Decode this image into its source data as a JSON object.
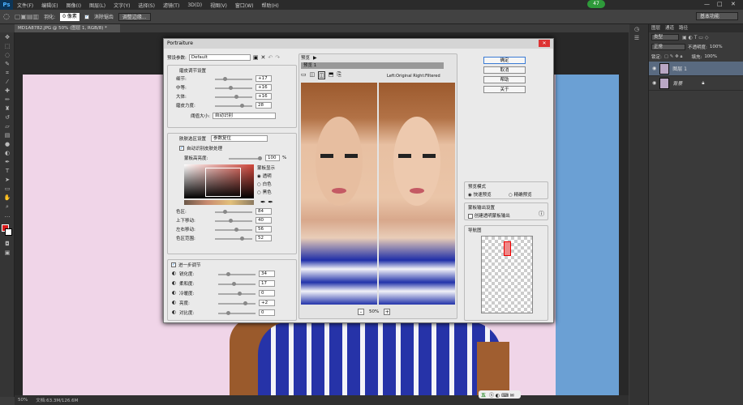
{
  "app": {
    "logo": "Ps",
    "window_controls": [
      "—",
      "□",
      "✕"
    ]
  },
  "menu": [
    "文件(F)",
    "编辑(E)",
    "图像(I)",
    "图层(L)",
    "文字(Y)",
    "选择(S)",
    "滤镜(T)",
    "3D(D)",
    "视图(V)",
    "窗口(W)",
    "帮助(H)"
  ],
  "options": {
    "feather_label": "羽化:",
    "feather_value": "0 像素",
    "antialias_label": "消除锯齿",
    "refine_button": "调整边缘...",
    "workspace": "基本功能"
  },
  "notice_badge": "47",
  "document": {
    "tab": "MD1A8782.JPG @ 50% (图层 1, RGB/8) *",
    "zoom": "50%",
    "doc_size": "文档:63.3M/126.6M"
  },
  "layers_panel": {
    "tabs": [
      "图层",
      "通道",
      "路径"
    ],
    "kind": "类型",
    "blend": "正常",
    "opacity_label": "不透明度:",
    "opacity": "100%",
    "lock_label": "锁定:",
    "fill_label": "填充:",
    "fill": "100%",
    "layers": [
      "图层 1",
      "背景"
    ]
  },
  "plugin": {
    "title": "Portraiture",
    "preset_label": "预设参数:",
    "preset_value": "Default",
    "detail_section": "磨皮调节设置",
    "sliders_detail": [
      {
        "label": "细节:",
        "value": "+17"
      },
      {
        "label": "中等:",
        "value": "+16"
      },
      {
        "label": "大体:",
        "value": "+16"
      },
      {
        "label": "磨皮力度:",
        "value": "28"
      }
    ],
    "threshold_label": "阈值大小:",
    "threshold_value": "自动识别",
    "skin_section": "肤肤选区设置",
    "skin_value": "参数复位",
    "auto_mask": "自动识别皮肤处理",
    "mask_feather_label": "蒙板高亮度:",
    "mask_feather_value": "100",
    "percent": "%",
    "mask_display": "蒙板显示",
    "radio_opts": [
      "透明",
      "白色",
      "黑色"
    ],
    "sliders_color": [
      {
        "label": "色区:",
        "value": "84"
      },
      {
        "label": "上下移动:",
        "value": "40"
      },
      {
        "label": "左右移动:",
        "value": "56"
      },
      {
        "label": "色区范围:",
        "value": "52"
      }
    ],
    "enhance_section": "进一步调节",
    "sliders_enhance": [
      {
        "label": "锐化度:",
        "value": "34"
      },
      {
        "label": "柔和度:",
        "value": "17"
      },
      {
        "label": "冷暖度:",
        "value": "0"
      },
      {
        "label": "亮度:",
        "value": "+2"
      },
      {
        "label": "对比度:",
        "value": "0"
      }
    ],
    "preview_label": "预览",
    "preview_tab": "预览 1",
    "split_label": "Left:Original Right:Filtered",
    "zoom": "50%",
    "buttons": {
      "ok": "确定",
      "cancel": "取消",
      "help": "帮助",
      "about": "关于"
    },
    "preview_mode": "预览模式",
    "mode_fast": "快速预览",
    "mode_precise": "精确预览",
    "mask_output": "蒙板输出设置",
    "mask_output_opt": "创建透明蒙板输出",
    "navigator": "导航图"
  },
  "taskbar_ime": "五"
}
